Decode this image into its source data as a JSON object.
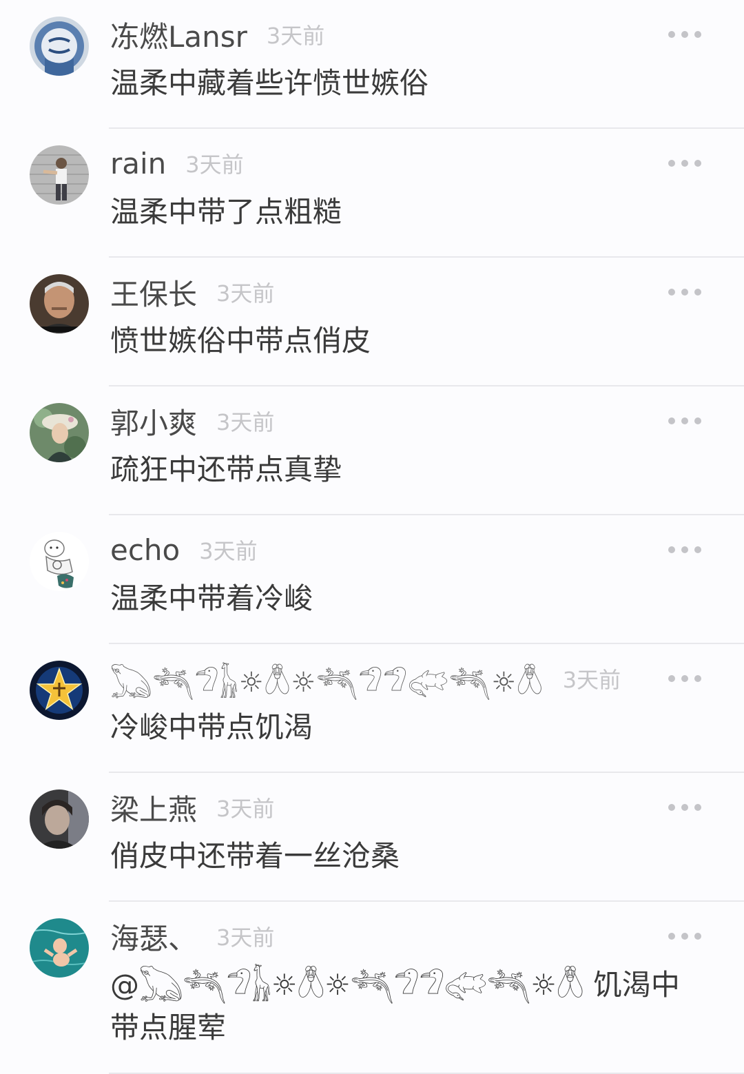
{
  "comments": [
    {
      "name": "冻燃Lansr",
      "time": "3天前",
      "text": "温柔中藏着些许愤世嫉俗",
      "avatar_icon": "blue-graffiti-avatar"
    },
    {
      "name": "rain",
      "time": "3天前",
      "text": "温柔中带了点粗糙",
      "avatar_icon": "person-wall-avatar"
    },
    {
      "name": "王保长",
      "time": "3天前",
      "text": "愤世嫉俗中带点俏皮",
      "avatar_icon": "man-portrait-avatar"
    },
    {
      "name": "郭小爽",
      "time": "3天前",
      "text": "疏狂中还带点真挚",
      "avatar_icon": "painting-woman-avatar"
    },
    {
      "name": "echo",
      "time": "3天前",
      "text": "温柔中带着冷峻",
      "avatar_icon": "cartoon-character-avatar"
    },
    {
      "name": "𓆏𓆈𓅿𓃱☼𓆦☼𓆈𓅿𓅿𓅾𓆈☼𓆦",
      "time": "3天前",
      "text": "冷峻中带点饥渴",
      "avatar_icon": "star-avatar"
    },
    {
      "name": "梁上燕",
      "time": "3天前",
      "text": "俏皮中还带着一丝沧桑",
      "avatar_icon": "dark-portrait-avatar"
    },
    {
      "name": "海瑟、",
      "time": "3天前",
      "text": "@𓆏𓆈𓅿𓃱☼𓆦☼𓆈𓅿𓅿𓅾𓆈☼𓆦 饥渴中带点腥荤",
      "avatar_icon": "underwater-baby-avatar"
    }
  ],
  "more_icon": "ellipsis-icon",
  "colors": {
    "name": "#4a4a4a",
    "time": "#c5c5c8",
    "text": "#3a3a3a",
    "divider": "#e8e8ec",
    "background": "#fcfcfe"
  }
}
